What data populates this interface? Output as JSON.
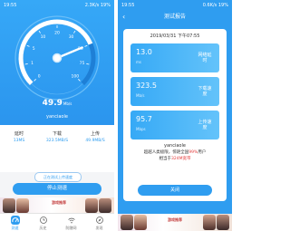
{
  "left": {
    "status": {
      "time": "19:55",
      "network": "2.3K/s",
      "battery": "19%"
    },
    "gauge": {
      "ticks": [
        "0",
        "1",
        "5",
        "10",
        "20",
        "30",
        "50",
        "75",
        "100"
      ],
      "needle_value": 49.9,
      "max": 100
    },
    "speed": {
      "value": "49.9",
      "unit": "Mb/s"
    },
    "ssid": "yanciaole",
    "stats": [
      {
        "label": "延时",
        "value": "13MS"
      },
      {
        "label": "下载",
        "value": "323.5MB/S"
      },
      {
        "label": "上传",
        "value": "49.9MB/S"
      }
    ],
    "link_button": "正在测试上传速度",
    "stop_button": "停止测速",
    "ad_text": "游戏推荐",
    "tabs": [
      {
        "label": "测速",
        "icon": "speedometer-icon"
      },
      {
        "label": "历史",
        "icon": "history-icon"
      },
      {
        "label": "防蹭网",
        "icon": "wifi-icon"
      },
      {
        "label": "发现",
        "icon": "discover-icon"
      }
    ]
  },
  "right": {
    "status": {
      "time": "19:55",
      "network": "0.6K/s",
      "battery": "19%"
    },
    "title": "测试报告",
    "date": "2019/03/31 下午07:55",
    "rows": [
      {
        "value": "13.0",
        "unit": "ms",
        "label": "网络延时"
      },
      {
        "value": "323.5",
        "unit": "Mb/s",
        "label": "下载速度"
      },
      {
        "value": "95.7",
        "unit": "Mbps",
        "label": "上传速度"
      }
    ],
    "ssid": "yanciaole",
    "beat_prefix": "超越人类极限，惊艳全国",
    "beat_percent": "99%",
    "beat_suffix": "用户",
    "equiv_prefix": "相当于",
    "equiv_value": "324M宽带",
    "close_button": "关闭",
    "ad_text": "游戏推荐"
  },
  "colors": {
    "primary": "#2f9df0",
    "card_gradient_end": "#64c3fa",
    "accent_red": "#e33b3b"
  }
}
